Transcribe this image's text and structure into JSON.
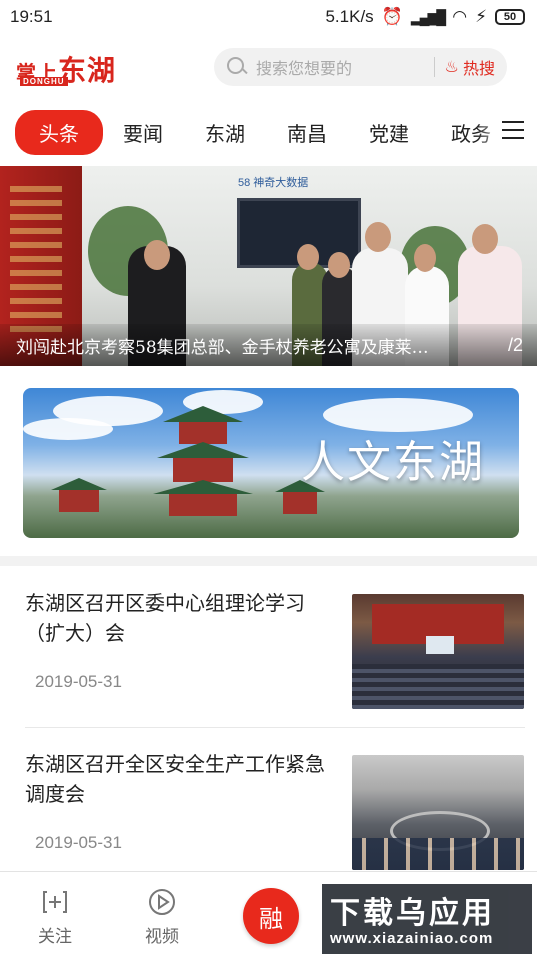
{
  "status_bar": {
    "time": "19:51",
    "network_speed": "5.1K/s",
    "battery": "50"
  },
  "header": {
    "logo_main": "掌上",
    "logo_accent": "东湖",
    "logo_sub": "DONGHU",
    "search_placeholder": "搜索您想要的",
    "hot_label": "热搜",
    "search_icon": "search-icon",
    "hot_icon": "fire-icon"
  },
  "tabs": [
    {
      "label": "头条",
      "active": true
    },
    {
      "label": "要闻",
      "active": false
    },
    {
      "label": "东湖",
      "active": false
    },
    {
      "label": "南昌",
      "active": false
    },
    {
      "label": "党建",
      "active": false
    },
    {
      "label": "政务",
      "active": false
    }
  ],
  "hero": {
    "caption": "刘闯赴北京考察58集团总部、金手杖养老公寓及康莱…",
    "page_indicator": "/2",
    "brand_text": "58 神奇大数据"
  },
  "culture_banner": {
    "title": "人文东湖"
  },
  "news": [
    {
      "title": "东湖区召开区委中心组理论学习（扩大）会",
      "date": "2019-05-31"
    },
    {
      "title": "东湖区召开全区安全生产工作紧急调度会",
      "date": "2019-05-31"
    }
  ],
  "bottom_nav": {
    "follow_label": "关注",
    "video_label": "视频",
    "center_label": "融"
  },
  "watermark": {
    "text": "下载乌应用",
    "url": "www.xiazainiao.com"
  },
  "colors": {
    "accent": "#e8291c",
    "logo": "#d8261d"
  }
}
